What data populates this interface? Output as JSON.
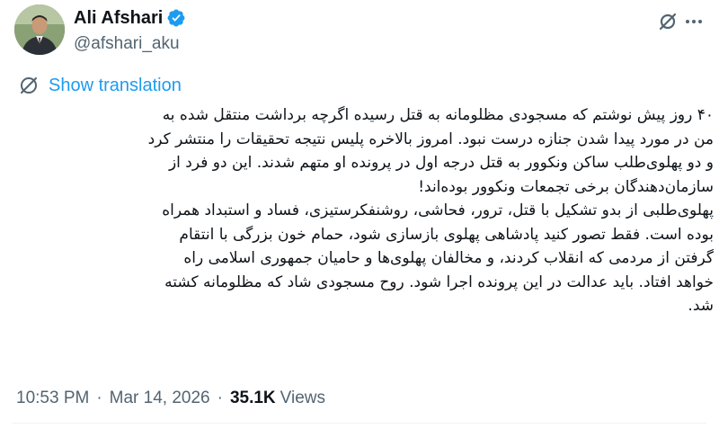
{
  "author": {
    "display_name": "Ali Afshari",
    "handle": "@afshari_aku",
    "verified": true
  },
  "translation": {
    "label": "Show translation"
  },
  "tweet": {
    "lines": [
      "۴۰ روز پیش نوشتم که مسجودی مظلومانه به قتل رسیده اگرچه برداشت منتقل شده به",
      "من در مورد پیدا شدن جنازه درست نبود. امروز بالاخره پلیس نتیجه تحقیقات را منتشر کرد",
      "و دو پهلوی‌طلب ساکن ونکوور به قتل درجه اول در پرونده او متهم شدند. این دو فرد از",
      "سازمان‌دهندگان برخی تجمعات ونکوور بوده‌اند!",
      "پهلوی‌طلبی از بدو تشکیل با قتل، ترور، فحاشی، روشنفکرستیزی، فساد و استبداد همراه",
      "بوده است. فقط تصور کنید پادشاهی پهلوی بازسازی شود، حمام خون بزرگی با انتقام",
      "گرفتن از مردمی که انقلاب کردند،  و مخالفان پهلوی‌ها و حامیان جمهوری اسلامی  راه",
      "خواهد افتاد. باید عدالت در این پرونده اجرا شود. روح مسجودی شاد که مظلومانه کشته",
      "شد."
    ]
  },
  "meta": {
    "time": "10:53 PM",
    "separator": "·",
    "date": "Mar 14, 2026",
    "views_count": "35.1K",
    "views_label": "Views"
  },
  "icons": {
    "verified": "verified-badge-icon",
    "grok": "grok-icon",
    "more": "more-options-icon",
    "translate": "globe-icon"
  },
  "colors": {
    "accent": "#1d9bf0",
    "text": "#0f1419",
    "muted": "#536471"
  }
}
